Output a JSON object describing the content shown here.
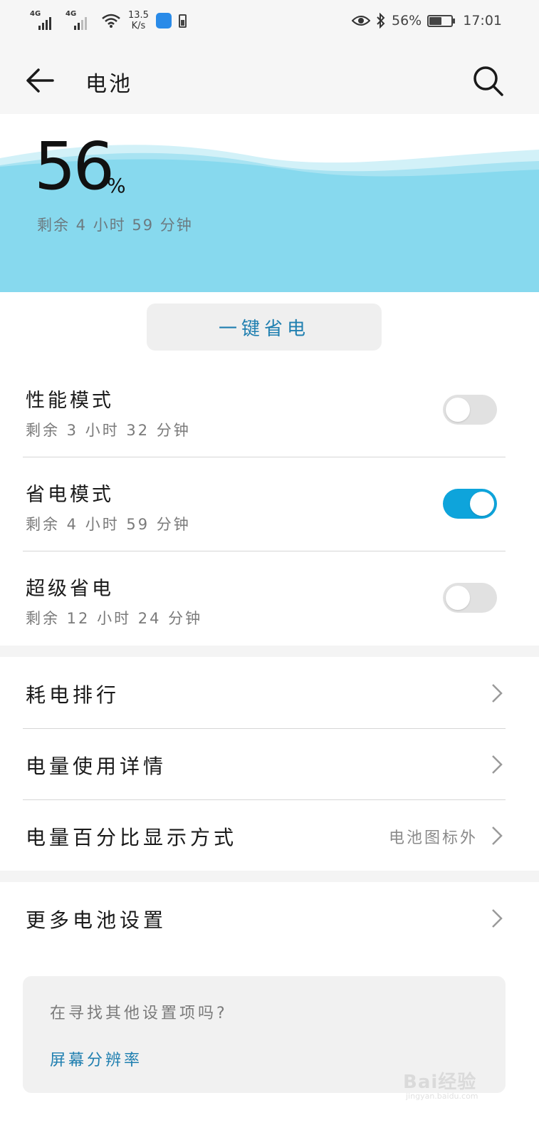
{
  "status_bar": {
    "signal1_tag": "4G",
    "signal2_tag": "4G",
    "speed_value": "13.5",
    "speed_unit": "K/s",
    "battery_percent": "56%",
    "time": "17:01",
    "battery_level": 0.56,
    "icons": [
      "signal-icon",
      "wifi-icon",
      "app-notification-icon",
      "battery-saver-icon",
      "eye-comfort-icon",
      "bluetooth-icon",
      "battery-icon"
    ]
  },
  "app_bar": {
    "title": "电池",
    "back_icon": "back-arrow-icon",
    "search_icon": "search-icon"
  },
  "hero": {
    "percent_value": "56",
    "percent_sign": "%",
    "remaining": "剩余 4 小时 59 分钟",
    "wave_color": "#87d9ee"
  },
  "save_button": {
    "label": "一键省电"
  },
  "modes": [
    {
      "title": "性能模式",
      "subtitle": "剩余 3 小时 32 分钟",
      "enabled": false
    },
    {
      "title": "省电模式",
      "subtitle": "剩余 4 小时 59 分钟",
      "enabled": true
    },
    {
      "title": "超级省电",
      "subtitle": "剩余 12 小时 24 分钟",
      "enabled": false
    }
  ],
  "list": [
    {
      "label": "耗电排行",
      "value": ""
    },
    {
      "label": "电量使用详情",
      "value": ""
    },
    {
      "label": "电量百分比显示方式",
      "value": "电池图标外"
    }
  ],
  "more": {
    "label": "更多电池设置"
  },
  "suggest": {
    "question": "在寻找其他设置项吗?",
    "link": "屏幕分辨率"
  },
  "watermark": {
    "brand": "Bai经验",
    "domain": "jingyan.baidu.com"
  },
  "colors": {
    "accent": "#0ea4db",
    "link": "#1f7fb0",
    "wave": "#87d9ee"
  }
}
